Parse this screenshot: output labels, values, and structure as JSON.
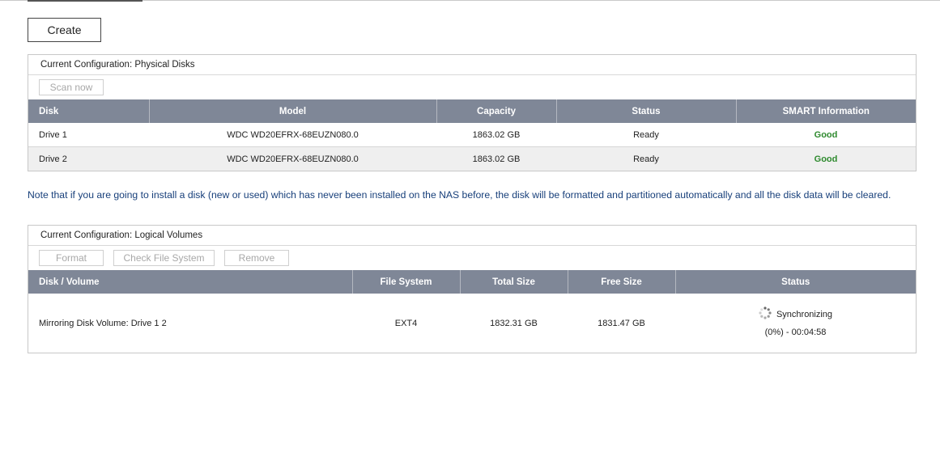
{
  "create_button": "Create",
  "physical": {
    "title": "Current Configuration: Physical Disks",
    "scan_now": "Scan now",
    "headers": [
      "Disk",
      "Model",
      "Capacity",
      "Status",
      "SMART Information"
    ],
    "rows": [
      {
        "disk": "Drive 1",
        "model": "WDC WD20EFRX-68EUZN080.0",
        "capacity": "1863.02 GB",
        "status": "Ready",
        "smart": "Good"
      },
      {
        "disk": "Drive 2",
        "model": "WDC WD20EFRX-68EUZN080.0",
        "capacity": "1863.02 GB",
        "status": "Ready",
        "smart": "Good"
      }
    ]
  },
  "note": "Note that if you are going to install a disk (new or used) which has never been installed on the NAS before, the disk will be formatted and partitioned automatically and all the disk data will be cleared.",
  "logical": {
    "title": "Current Configuration: Logical Volumes",
    "buttons": {
      "format": "Format",
      "check_fs": "Check File System",
      "remove": "Remove"
    },
    "headers": [
      "Disk / Volume",
      "File System",
      "Total Size",
      "Free Size",
      "Status"
    ],
    "rows": [
      {
        "volume": "Mirroring Disk Volume: Drive 1 2",
        "fs": "EXT4",
        "total": "1832.31 GB",
        "free": "1831.47 GB",
        "status": "Synchronizing",
        "progress": "(0%) - 00:04:58"
      }
    ]
  },
  "icons": {
    "sync": "spinner-icon"
  },
  "colors": {
    "header_bg": "#7f8797",
    "good": "#2e8a2e",
    "note": "#173f7a"
  }
}
